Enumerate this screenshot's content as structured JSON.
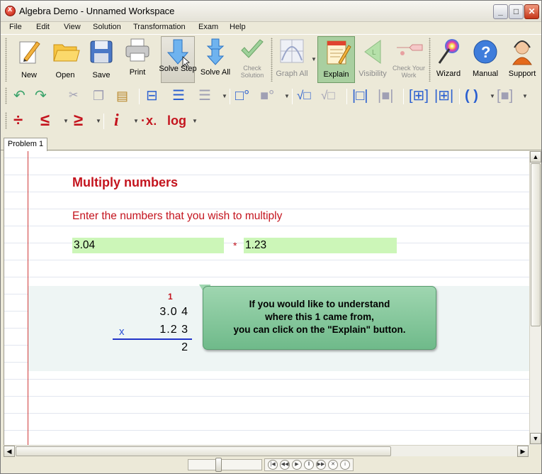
{
  "window": {
    "title": "Algebra Demo - Unnamed Workspace"
  },
  "menu": [
    "File",
    "Edit",
    "View",
    "Solution",
    "Transformation",
    "Exam",
    "Help"
  ],
  "toolbar": {
    "new": "New",
    "open": "Open",
    "save": "Save",
    "print": "Print",
    "solve_step": "Solve Step",
    "solve_all": "Solve All",
    "check_solution": "Check Solution",
    "graph_all": "Graph All",
    "explain": "Explain",
    "visibility": "Visibility",
    "check_work": "Check Your Work",
    "wizard": "Wizard",
    "manual": "Manual",
    "support": "Support"
  },
  "format_row": {
    "sep_sym": "÷",
    "le": "≤",
    "ge": "≥",
    "italic_i": "i",
    "x_sub": "x",
    "log": "log"
  },
  "tabs": [
    "Problem 1"
  ],
  "problem": {
    "title": "Multiply numbers",
    "instruction": "Enter the numbers that you wish to multiply",
    "operand1": "3.04",
    "operator": "*",
    "operand2": "1.23"
  },
  "work": {
    "carry": "1",
    "top": "3.0 4",
    "op": "x",
    "bottom": "1.2 3",
    "partial": "2"
  },
  "tooltip": {
    "line1": "If you would like to understand",
    "line2": "where this 1 came from,",
    "line3": "you can click on the \"Explain\" button."
  },
  "colors": {
    "accent_red": "#c4141e",
    "input_green": "#ccf6b8",
    "tooltip_green": "#8fcc9f",
    "rule_blue": "#2233c8"
  }
}
